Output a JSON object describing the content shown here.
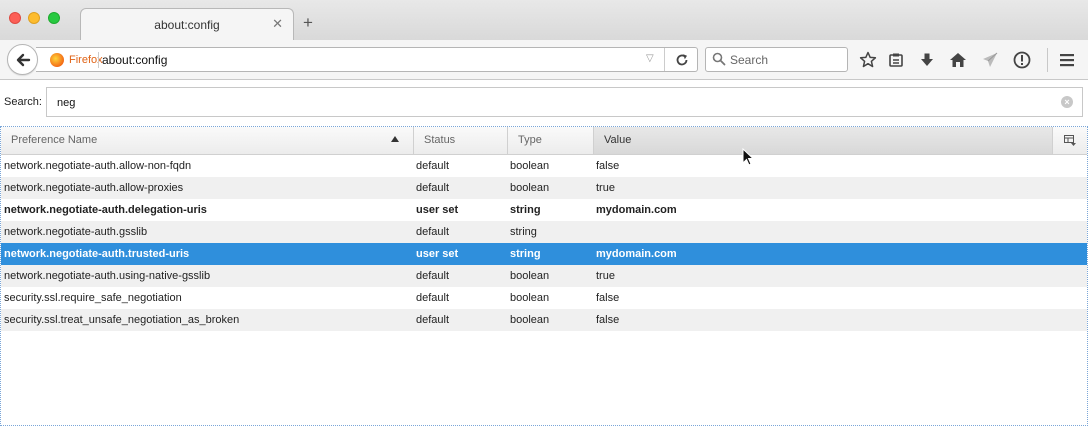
{
  "tab": {
    "title": "about:config"
  },
  "navbar": {
    "identity_label": "Firefox",
    "url": "about:config",
    "search_placeholder": "Search"
  },
  "config": {
    "search_label": "Search:",
    "filter_value": "neg",
    "columns": {
      "name": "Preference Name",
      "status": "Status",
      "type": "Type",
      "value": "Value"
    },
    "sorted_column": "Preference Name",
    "sort_direction": "ascending",
    "rows": [
      {
        "name": "network.negotiate-auth.allow-non-fqdn",
        "status": "default",
        "type": "boolean",
        "value": "false",
        "modified": false,
        "selected": false
      },
      {
        "name": "network.negotiate-auth.allow-proxies",
        "status": "default",
        "type": "boolean",
        "value": "true",
        "modified": false,
        "selected": false
      },
      {
        "name": "network.negotiate-auth.delegation-uris",
        "status": "user set",
        "type": "string",
        "value": "mydomain.com",
        "modified": true,
        "selected": false
      },
      {
        "name": "network.negotiate-auth.gsslib",
        "status": "default",
        "type": "string",
        "value": "",
        "modified": false,
        "selected": false
      },
      {
        "name": "network.negotiate-auth.trusted-uris",
        "status": "user set",
        "type": "string",
        "value": "mydomain.com",
        "modified": true,
        "selected": true
      },
      {
        "name": "network.negotiate-auth.using-native-gsslib",
        "status": "default",
        "type": "boolean",
        "value": "true",
        "modified": false,
        "selected": false
      },
      {
        "name": "security.ssl.require_safe_negotiation",
        "status": "default",
        "type": "boolean",
        "value": "false",
        "modified": false,
        "selected": false
      },
      {
        "name": "security.ssl.treat_unsafe_negotiation_as_broken",
        "status": "default",
        "type": "boolean",
        "value": "false",
        "modified": false,
        "selected": false
      }
    ]
  },
  "icons": {
    "back": "back-arrow-icon",
    "reload": "reload-icon",
    "bookmark": "star-icon",
    "reading_list": "clipboard-icon",
    "downloads": "download-arrow-icon",
    "home": "home-icon",
    "share": "paper-plane-icon",
    "extension": "info-circle-icon",
    "menu": "hamburger-menu-icon"
  },
  "colors": {
    "selection": "#2f8fdc",
    "identity": "#e06316",
    "close_button": "#fc5f57",
    "minimize_button": "#fdbc2e",
    "zoom_button": "#28c941"
  }
}
